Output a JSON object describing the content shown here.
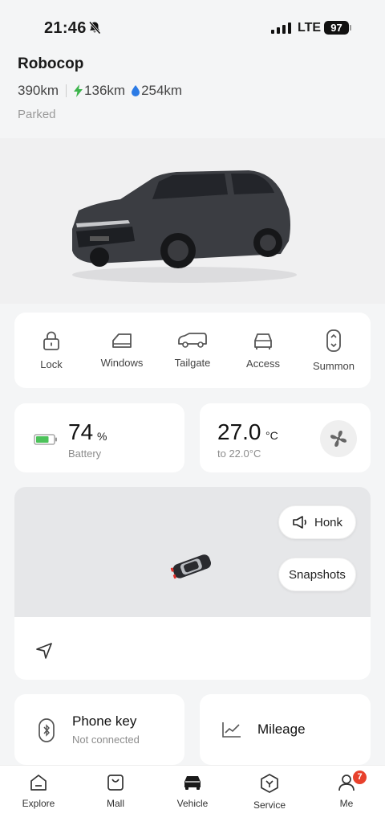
{
  "status_bar": {
    "time": "21:46",
    "network": "LTE",
    "battery": "97"
  },
  "vehicle": {
    "name": "Robocop",
    "total_range": "390km",
    "electric_range": "136km",
    "fuel_range": "254km",
    "state": "Parked"
  },
  "controls": [
    {
      "label": "Lock",
      "icon": "lock-icon"
    },
    {
      "label": "Windows",
      "icon": "window-icon"
    },
    {
      "label": "Tailgate",
      "icon": "tailgate-icon"
    },
    {
      "label": "Access",
      "icon": "car-access-icon"
    },
    {
      "label": "Summon",
      "icon": "summon-icon"
    }
  ],
  "battery": {
    "value": "74",
    "unit": "%",
    "label": "Battery",
    "fill_fraction": 0.74,
    "color": "#4cc25a"
  },
  "climate": {
    "value": "27.0",
    "unit": "°C",
    "target": "to 22.0°C"
  },
  "map": {
    "honk_label": "Honk",
    "snapshots_label": "Snapshots"
  },
  "phone_key": {
    "title": "Phone key",
    "status": "Not connected"
  },
  "mileage": {
    "title": "Mileage"
  },
  "tabs": [
    {
      "label": "Explore",
      "icon": "explore-icon"
    },
    {
      "label": "Mall",
      "icon": "shopping-bag-icon"
    },
    {
      "label": "Vehicle",
      "icon": "car-icon"
    },
    {
      "label": "Service",
      "icon": "service-icon"
    },
    {
      "label": "Me",
      "icon": "profile-icon",
      "badge": "7"
    }
  ],
  "colors": {
    "electric": "#3cb44b",
    "fuel": "#2c7be5",
    "badge": "#e8412c"
  }
}
